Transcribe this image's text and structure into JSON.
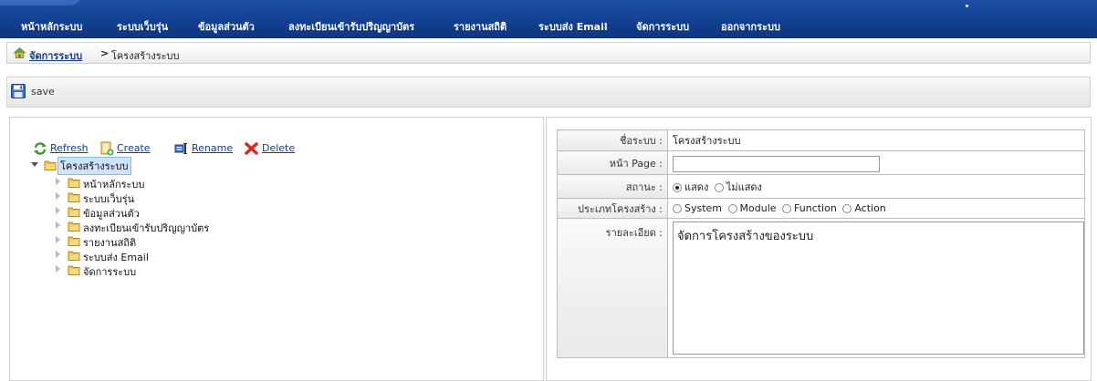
{
  "nav": {
    "items": [
      {
        "label": "หน้าหลักระบบ"
      },
      {
        "label": "ระบบเว็บรุ่น"
      },
      {
        "label": "ข้อมูลส่วนตัว"
      },
      {
        "label": "ลงทะเบียนเข้ารับปริญญาบัตร"
      },
      {
        "label": "รายงานสถิติ"
      },
      {
        "label": "ระบบส่ง Email"
      },
      {
        "label": "จัดการระบบ"
      },
      {
        "label": "ออกจากระบบ"
      }
    ]
  },
  "breadcrumb": {
    "link": "จัดการระบบ",
    "separator": ">",
    "current": "โครงสร้างระบบ"
  },
  "toolbar": {
    "save_label": "save"
  },
  "tree_actions": {
    "refresh": "Refresh",
    "create": "Create",
    "rename": "Rename",
    "delete": "Delete"
  },
  "tree": {
    "root": "โครงสร้างระบบ",
    "children": [
      {
        "label": "หน้าหลักระบบ"
      },
      {
        "label": "ระบบเว็บรุ่น"
      },
      {
        "label": "ข้อมูลส่วนตัว"
      },
      {
        "label": "ลงทะเบียนเข้ารับปริญญาบัตร"
      },
      {
        "label": "รายงานสถิติ"
      },
      {
        "label": "ระบบส่ง Email"
      },
      {
        "label": "จัดการระบบ"
      }
    ]
  },
  "form": {
    "name_label": "ชื่อระบบ :",
    "name_value": "โครงสร้างระบบ",
    "page_label": "หน้า Page :",
    "page_value": "",
    "status_label": "สถานะ :",
    "status_options": [
      "แสดง",
      "ไม่แสดง"
    ],
    "status_selected": "แสดง",
    "type_label": "ประเภทโครงสร้าง :",
    "type_options": [
      "System",
      "Module",
      "Function",
      "Action"
    ],
    "detail_label": "รายละเอียด :",
    "detail_value": "จัดการโครงสร้างของระบบ"
  },
  "colors": {
    "nav_bg": "#123f8f",
    "link": "#1a3b8c",
    "selected_node_bg": "#cfe3fb"
  }
}
